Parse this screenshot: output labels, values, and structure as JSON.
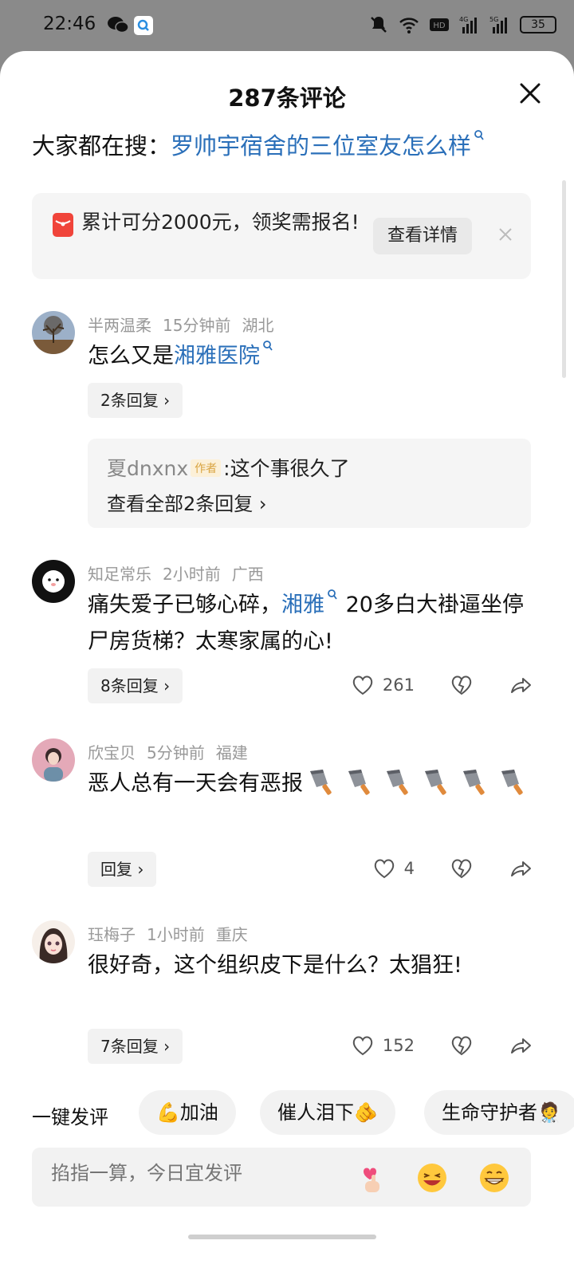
{
  "status_bar": {
    "time": "22:46",
    "battery": "35"
  },
  "sheet": {
    "title": "287条评论"
  },
  "search": {
    "prefix": "大家都在搜：",
    "query": "罗帅宇宿舍的三位室友怎么样"
  },
  "banner": {
    "text": "累计可分2000元，领奖需报名!",
    "button": "查看详情"
  },
  "comments": [
    {
      "user": "半两温柔",
      "time": "15分钟前",
      "location": "湖北",
      "text_before": "怎么又是",
      "link": "湘雅医院",
      "text_after": "",
      "reply_label": "2条回复",
      "sub_reply": {
        "user": "夏dnxnx",
        "tag": "作者",
        "text": ":这个事很久了",
        "view_all": "查看全部2条回复"
      }
    },
    {
      "user": "知足常乐",
      "time": "2小时前",
      "location": "广西",
      "text_before": "痛失爱子已够心碎，",
      "link": "湘雅",
      "text_after": "20多白大褂逼坐停尸房货梯？太寒家属的心!",
      "reply_label": "8条回复",
      "likes": "261"
    },
    {
      "user": "欣宝贝",
      "time": "5分钟前",
      "location": "福建",
      "text_before": "恶人总有一天会有恶报",
      "emoji": "cleaver-knife x6",
      "reply_label": "回复",
      "likes": "4"
    },
    {
      "user": "珏梅子",
      "time": "1小时前",
      "location": "重庆",
      "text_before": "很好奇，这个组织皮下是什么？太猖狂!",
      "reply_label": "7条回复",
      "likes": "152"
    }
  ],
  "quick_comment": {
    "label": "一键发评",
    "chips": [
      "💪加油",
      "催人泪下🫵",
      "生命守护者🧑‍⚕️"
    ]
  },
  "composer": {
    "placeholder": "掐指一算，今日宜发评"
  },
  "colors": {
    "link": "#2a6fb9",
    "accent_red": "#f0443a",
    "background": "#ffffff",
    "overlay": "#8a8a8a"
  }
}
